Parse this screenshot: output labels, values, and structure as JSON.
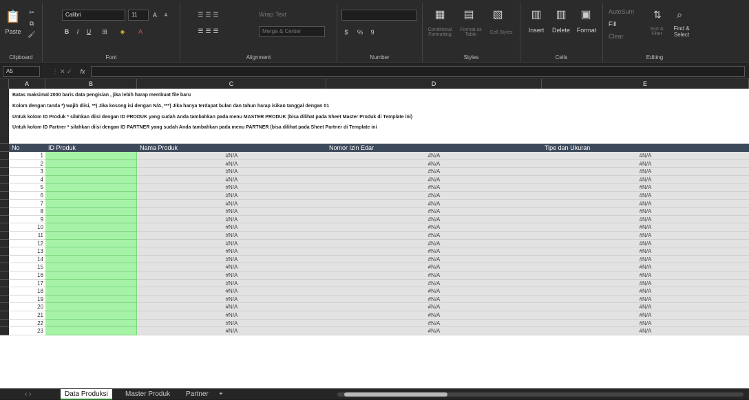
{
  "ribbon": {
    "clipboard": {
      "label": "Clipboard",
      "paste": "Paste"
    },
    "font": {
      "label": "Font",
      "name": "Calibri",
      "size": "11",
      "bold": "B",
      "italic": "I",
      "underline": "U"
    },
    "alignment": {
      "label": "Alignment",
      "wrap": "Wrap Text",
      "merge": "Merge & Center"
    },
    "number": {
      "label": "Number",
      "currency": "$",
      "percent": "%",
      "comma": "9"
    },
    "styles": {
      "label": "Styles",
      "conditional": "Conditional Formatting",
      "format_table": "Format as Table",
      "cell_styles": "Cell Styles"
    },
    "cells": {
      "label": "Cells",
      "insert": "Insert",
      "delete": "Delete",
      "format": "Format"
    },
    "editing": {
      "label": "Editing",
      "autosum": "AutoSum",
      "fill": "Fill",
      "clear": "Clear",
      "sort": "Sort & Filter",
      "find": "Find & Select"
    }
  },
  "formula_bar": {
    "name_box": "A5",
    "fx": "fx",
    "value": ""
  },
  "columns": [
    "A",
    "B",
    "C",
    "D",
    "E"
  ],
  "notes": [
    "Batas maksimal 2000 baris data pengisian , jika lebih harap membuat file baru",
    "Kolom dengan tanda *) wajib diisi, **) Jika kosong isi dengan N/A, ***) Jika hanya terdapat bulan dan tahun harap isikan tanggal dengan 01",
    "Untuk kolom ID Produk * silahkan diisi dengan ID PRODUK yang sudah Anda tambahkan pada menu MASTER PRODUK (bisa dilihat pada Sheet Master Produk di Template ini)",
    "Untuk kolom ID Partner * silahkan diisi dengan ID PARTNER yang sudah Anda tambahkan pada menu PARTNER (bisa dilihat pada Sheet Partner di Template ini"
  ],
  "table_header": [
    "No",
    "ID Produk",
    "Nama Produk",
    "Nomor Izin Edar",
    "Tipe dan Ukuran"
  ],
  "na": "#N/A",
  "rows": [
    "1",
    "2",
    "3",
    "4",
    "5",
    "6",
    "7",
    "8",
    "9",
    "10",
    "11",
    "12",
    "13",
    "14",
    "15",
    "16",
    "17",
    "18",
    "19",
    "20",
    "21",
    "22",
    "23"
  ],
  "tabs": [
    "Data Produksi",
    "Master Produk",
    "Partner"
  ],
  "add_tab": "+"
}
